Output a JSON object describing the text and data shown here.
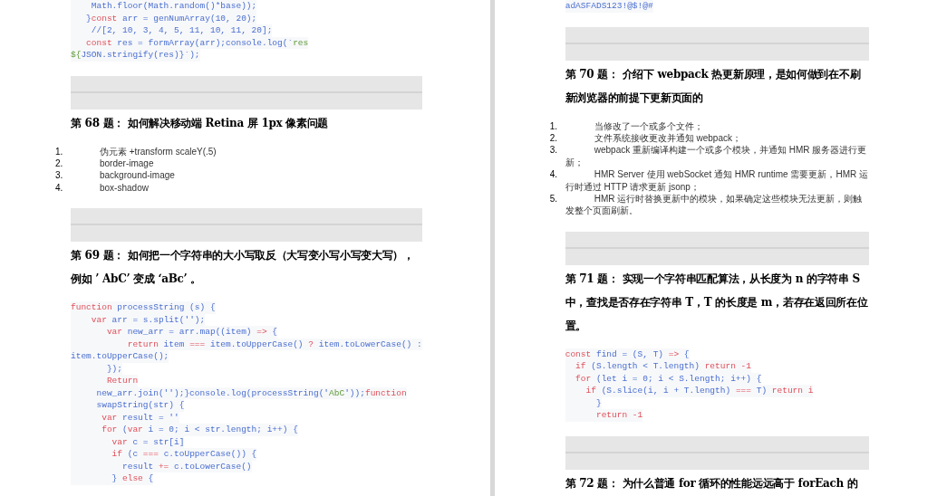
{
  "pages": [
    {
      "blocks": [
        {
          "kind": "code",
          "lines": [
            [
              {
                "text": "    Math.floor(Math.random()*base));",
                "kind": "plain"
              }
            ],
            [
              {
                "text": "   }",
                "kind": "plain"
              },
              {
                "text": "const",
                "kind": "kw"
              },
              {
                "text": " arr = genNumArray(10, 20);",
                "kind": "plain"
              }
            ],
            [
              {
                "text": "    //[2, 10, 3, 4, 5, 11, 10, 11, 20];",
                "kind": "plain"
              }
            ],
            [
              {
                "text": "   const",
                "kind": "kw"
              },
              {
                "text": " res = formArray(arr);console.log(`",
                "kind": "plain"
              },
              {
                "text": "res",
                "kind": "str"
              }
            ],
            [
              {
                "text": "${",
                "kind": "str"
              },
              {
                "text": "JSON.stringify(res)}`);",
                "kind": "plain"
              }
            ]
          ]
        },
        {
          "kind": "separator"
        },
        {
          "kind": "heading",
          "text": "第 68 题： 如何解决移动端 Retina 屏 1px 像素问题"
        },
        {
          "kind": "list",
          "items": [
            {
              "number": "1.",
              "text": "伪元素 +transform scaleY(.5)"
            },
            {
              "number": "2.",
              "text": "border-image"
            },
            {
              "number": "3.",
              "text": "background-image"
            },
            {
              "number": "4.",
              "text": "box-shadow"
            }
          ]
        },
        {
          "kind": "separator"
        },
        {
          "kind": "heading",
          "text": "第 69 题： 如何把一个字符串的大小写取反（大写变小写小写变大写），例如 ’ AbC’ 变成 ‘aBc’ 。"
        },
        {
          "kind": "code",
          "lines": [
            [
              {
                "text": "function",
                "kind": "kw"
              },
              {
                "text": " processString (s) {",
                "kind": "plain"
              }
            ],
            [
              {
                "text": "    var",
                "kind": "kw"
              },
              {
                "text": " arr = s.split('');",
                "kind": "plain"
              }
            ],
            [
              {
                "text": "       var",
                "kind": "kw"
              },
              {
                "text": " new_arr = arr.map((item) ",
                "kind": "plain"
              },
              {
                "text": "=>",
                "kind": "kw"
              },
              {
                "text": " {",
                "kind": "plain"
              }
            ],
            [
              {
                "text": "           return",
                "kind": "kw"
              },
              {
                "text": " item ",
                "kind": "plain"
              },
              {
                "text": "===",
                "kind": "kw"
              },
              {
                "text": " item.toUpperCase() ",
                "kind": "plain"
              },
              {
                "text": "?",
                "kind": "kw"
              },
              {
                "text": " item.toLowerCase() :",
                "kind": "plain"
              }
            ],
            [
              {
                "text": "item.toUpperCase();",
                "kind": "plain"
              }
            ],
            [
              {
                "text": "       });",
                "kind": "plain"
              }
            ],
            [
              {
                "text": "       Return",
                "kind": "kw"
              }
            ],
            [
              {
                "text": "     new_arr.join('');}console.log(processString('",
                "kind": "plain"
              },
              {
                "text": "AbC",
                "kind": "str"
              },
              {
                "text": "'));",
                "kind": "plain"
              },
              {
                "text": "function",
                "kind": "kw"
              }
            ],
            [
              {
                "text": "     swapString(str) {",
                "kind": "plain"
              }
            ],
            [
              {
                "text": "      var",
                "kind": "kw"
              },
              {
                "text": " result = ''",
                "kind": "plain"
              }
            ],
            [
              {
                "text": "      for",
                "kind": "kw"
              },
              {
                "text": " (",
                "kind": "plain"
              },
              {
                "text": "var",
                "kind": "kw"
              },
              {
                "text": " i = 0; i < str.length; i++) {",
                "kind": "plain"
              }
            ],
            [
              {
                "text": "        var",
                "kind": "kw"
              },
              {
                "text": " c = str[i]",
                "kind": "plain"
              }
            ],
            [
              {
                "text": "        if",
                "kind": "kw"
              },
              {
                "text": " (c ",
                "kind": "plain"
              },
              {
                "text": "===",
                "kind": "kw"
              },
              {
                "text": " c.toUpperCase()) {",
                "kind": "plain"
              }
            ],
            [
              {
                "text": "          result ",
                "kind": "plain"
              },
              {
                "text": "+=",
                "kind": "kw"
              },
              {
                "text": " c.toLowerCase()",
                "kind": "plain"
              }
            ],
            [
              {
                "text": "        } ",
                "kind": "plain"
              },
              {
                "text": "else",
                "kind": "kw"
              },
              {
                "text": " {",
                "kind": "plain"
              }
            ]
          ]
        }
      ]
    },
    {
      "blocks": [
        {
          "kind": "code",
          "lines": [
            [
              {
                "text": "adASFADS123!@$!@#",
                "kind": "plain"
              }
            ]
          ]
        },
        {
          "kind": "separator"
        },
        {
          "kind": "heading",
          "text": "第 70 题： 介绍下 webpack 热更新原理，是如何做到在不刷新浏览器的前提下更新页面的"
        },
        {
          "kind": "list",
          "items": [
            {
              "number": "1.",
              "text": "当修改了一个或多个文件；"
            },
            {
              "number": "2.",
              "text": "文件系统接收更改并通知 webpack；"
            },
            {
              "number": "3.",
              "text": "webpack 重新编译构建一个或多个模块，并通知 HMR 服务器进行更新；"
            },
            {
              "number": "4.",
              "text": "HMR Server  使用 webSocket 通知 HMR runtime  需要更新，HMR 运行时通过 HTTP 请求更新 jsonp；"
            },
            {
              "number": "5.",
              "text": "HMR 运行时替换更新中的模块，如果确定这些模块无法更新，则触发整个页面刷新。"
            }
          ]
        },
        {
          "kind": "separator"
        },
        {
          "kind": "heading",
          "text": "第 71 题： 实现一个字符串匹配算法，从长度为 n 的字符串 S 中，查找是否存在字符串 T，T 的长度是 m，若存在返回所在位置。"
        },
        {
          "kind": "code",
          "lines": [
            [
              {
                "text": "const",
                "kind": "kw"
              },
              {
                "text": " find = (S, T) ",
                "kind": "plain"
              },
              {
                "text": "=>",
                "kind": "kw"
              },
              {
                "text": " {",
                "kind": "plain"
              }
            ],
            [
              {
                "text": "  if",
                "kind": "kw"
              },
              {
                "text": " (S.length < T.length) ",
                "kind": "plain"
              },
              {
                "text": "return -1",
                "kind": "kw"
              }
            ],
            [
              {
                "text": "  for",
                "kind": "kw"
              },
              {
                "text": " (let i = 0; i < S.length; i++) {",
                "kind": "plain"
              }
            ],
            [
              {
                "text": "    if",
                "kind": "kw"
              },
              {
                "text": " (S.slice(i, i + T.length) ",
                "kind": "plain"
              },
              {
                "text": "===",
                "kind": "kw"
              },
              {
                "text": " T) ",
                "kind": "plain"
              },
              {
                "text": "return i",
                "kind": "kw"
              }
            ],
            [
              {
                "text": "      }",
                "kind": "plain"
              }
            ],
            [
              {
                "text": "      return -1",
                "kind": "kw"
              }
            ]
          ]
        },
        {
          "kind": "separator"
        },
        {
          "kind": "heading",
          "text": "第 72 题： 为什么普通 for 循环的性能远远高于 forEach 的"
        }
      ]
    }
  ]
}
